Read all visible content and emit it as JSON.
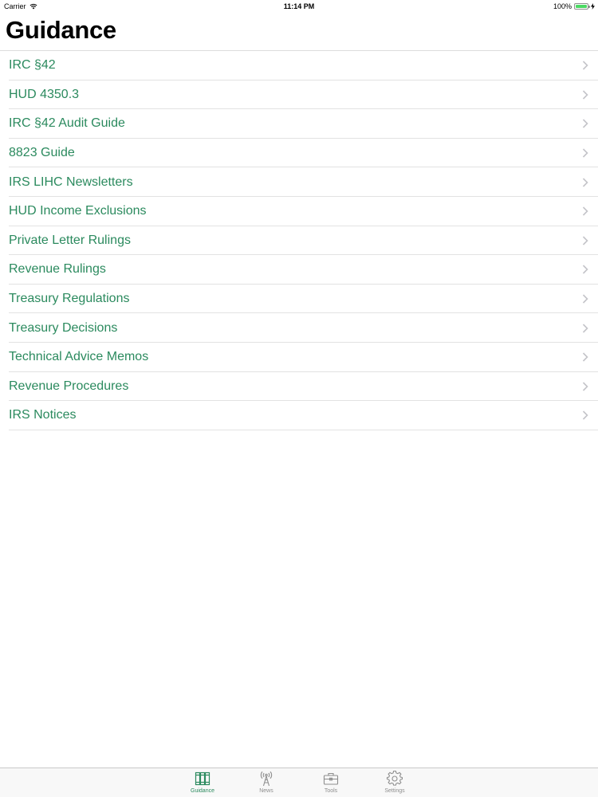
{
  "status_bar": {
    "carrier": "Carrier",
    "time": "11:14 PM",
    "battery": "100%",
    "battery_level": 1.0
  },
  "header": {
    "title": "Guidance"
  },
  "list": {
    "items": [
      {
        "label": "IRC §42"
      },
      {
        "label": "HUD 4350.3"
      },
      {
        "label": "IRC §42 Audit Guide"
      },
      {
        "label": "8823 Guide"
      },
      {
        "label": "IRS LIHC Newsletters"
      },
      {
        "label": "HUD Income Exclusions"
      },
      {
        "label": "Private Letter Rulings"
      },
      {
        "label": "Revenue Rulings"
      },
      {
        "label": "Treasury Regulations"
      },
      {
        "label": "Treasury Decisions"
      },
      {
        "label": "Technical Advice Memos"
      },
      {
        "label": "Revenue Procedures"
      },
      {
        "label": "IRS Notices"
      }
    ]
  },
  "tab_bar": {
    "tabs": [
      {
        "label": "Guidance",
        "icon": "books-icon",
        "active": true
      },
      {
        "label": "News",
        "icon": "antenna-icon",
        "active": false
      },
      {
        "label": "Tools",
        "icon": "toolbox-icon",
        "active": false
      },
      {
        "label": "Settings",
        "icon": "gear-icon",
        "active": false
      }
    ]
  },
  "colors": {
    "accent": "#2b8a5e",
    "inactive_tab": "#8e8e8e",
    "battery": "#4cd964"
  }
}
